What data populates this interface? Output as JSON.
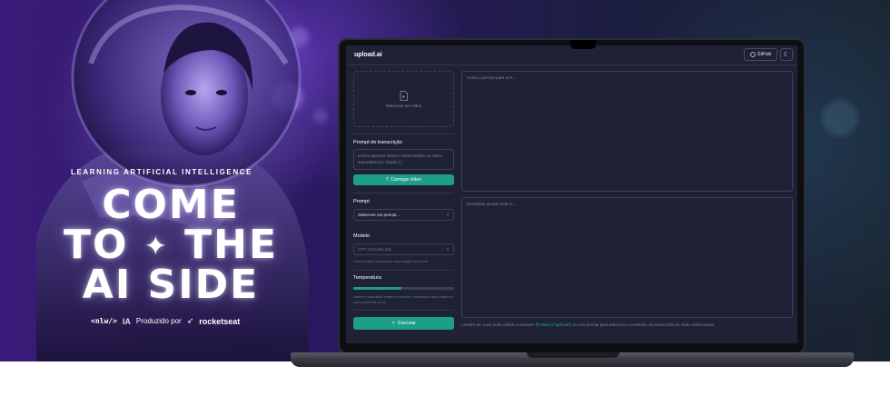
{
  "hero": {
    "tagline": "LEARNING ARTIFICIAL INTELLIGENCE",
    "headline_line1": "COME",
    "headline_line2_a": "TO",
    "headline_line2_b": "THE",
    "headline_line3": "AI SIDE",
    "sparkle_icon": "four-point-star",
    "credits": {
      "nlw": "<nlw/>",
      "ia": "IA",
      "produced_by": "Produzido por",
      "brand": "rocketseat"
    }
  },
  "app": {
    "logo": "upload.ai",
    "github_label": "GitHub",
    "theme_icon": "moon",
    "upload": {
      "dropzone_label": "Selecione um vídeo",
      "transcription_label": "Prompt de transcrição",
      "transcription_placeholder": "Inclua palavras-chaves mencionadas no vídeo separadas por vírgula (,)",
      "upload_button": "Carregar vídeo"
    },
    "prompt": {
      "label": "Prompt",
      "select_placeholder": "Selecione um prompt..."
    },
    "model": {
      "label": "Modelo",
      "value": "GPT 3.5-turbo 16k",
      "hint": "Você poderá customizar essa opção em breve"
    },
    "temperature": {
      "label": "Temperatura",
      "value_fraction": 0.48,
      "hint": "Valores mais altos tendem a deixar o resultado mais criativo e com possíveis erros."
    },
    "execute_button": "Executar",
    "prompt_area_placeholder": "Inclua o prompt para a IA...",
    "result_area_placeholder": "Resultado gerado pela IA...",
    "footer": {
      "before": "Lembre-se: você pode utilizar a variável",
      "code": "{transcription}",
      "after": "no seu prompt para adicionar o conteúdo da transcrição do vídeo selecionado."
    }
  },
  "colors": {
    "accent_green": "#1f9e86",
    "code_green": "#1fc7a4",
    "screen_bg": "#1f2235",
    "banner_purple": "#3a1c7a"
  }
}
